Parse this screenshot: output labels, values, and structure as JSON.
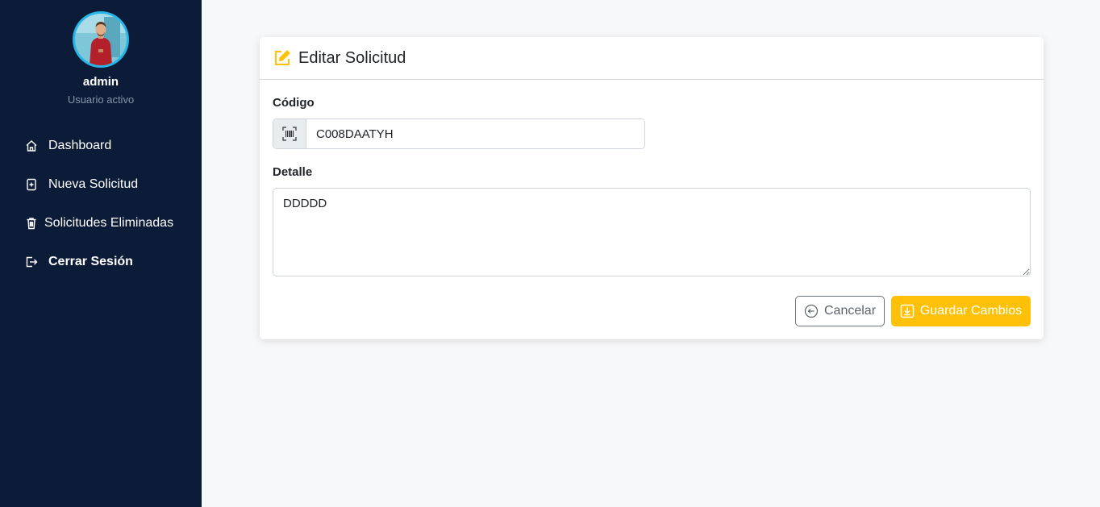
{
  "sidebar": {
    "user": {
      "name": "admin",
      "status": "Usuario activo"
    },
    "items": [
      {
        "label": "Dashboard",
        "icon": "home-icon"
      },
      {
        "label": "Nueva Solicitud",
        "icon": "file-plus-icon"
      },
      {
        "label": "Solicitudes Eliminadas",
        "icon": "trash-icon"
      },
      {
        "label": "Cerrar Sesión",
        "icon": "logout-icon"
      }
    ]
  },
  "form": {
    "title": "Editar Solicitud",
    "codigo_label": "Código",
    "codigo_value": "C008DAATYH",
    "detalle_label": "Detalle",
    "detalle_value": "DDDDD",
    "cancel_label": "Cancelar",
    "save_label": "Guardar Cambios"
  },
  "colors": {
    "sidebar_bg": "#0c1c38",
    "accent": "#ffc107",
    "avatar_ring": "#25b6e6"
  }
}
